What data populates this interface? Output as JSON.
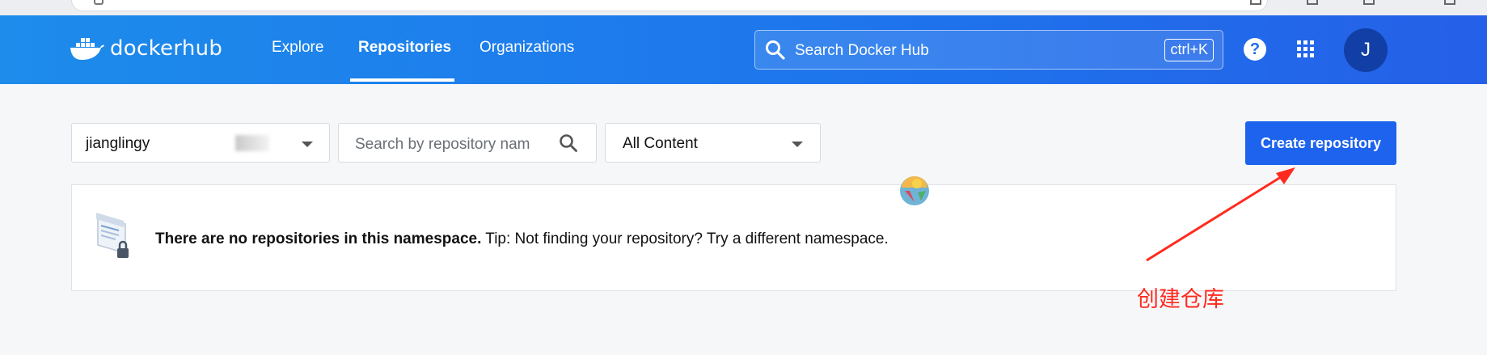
{
  "header": {
    "logo": {
      "docker": "docker",
      "hub": "hub"
    },
    "nav": [
      {
        "label": "Explore",
        "active": false
      },
      {
        "label": "Repositories",
        "active": true
      },
      {
        "label": "Organizations",
        "active": false
      }
    ],
    "search": {
      "placeholder": "Search Docker Hub",
      "shortcut": "ctrl+K"
    },
    "help": "?",
    "avatar_initial": "J"
  },
  "filters": {
    "namespace": "jianglingy",
    "repo_search_placeholder": "Search by repository nam",
    "content_filter": "All Content"
  },
  "actions": {
    "create_label": "Create repository"
  },
  "empty_state": {
    "bold": "There are no repositories in this namespace.",
    "tip": " Tip: Not finding your repository? Try a different namespace."
  },
  "annotation": {
    "text": "创建仓库",
    "color": "#ff2a1f"
  },
  "colors": {
    "header_start": "#1d8ceb",
    "header_end": "#2560e8",
    "primary_button": "#1d63ed",
    "avatar": "#123fa6"
  },
  "icons": [
    "docker-whale-icon",
    "search-icon",
    "help-icon",
    "apps-grid-icon",
    "chevron-down-icon",
    "repository-lock-icon"
  ]
}
